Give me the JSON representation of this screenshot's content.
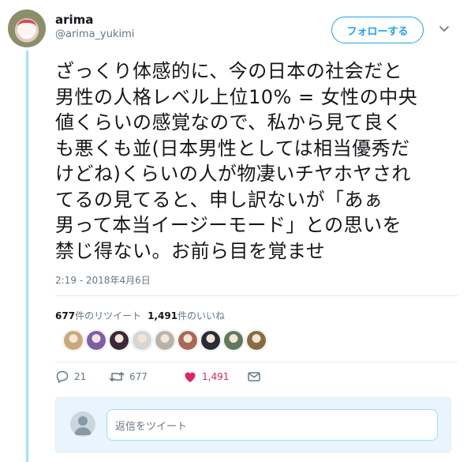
{
  "user": {
    "display_name": "arima",
    "screen_name": "@arima_yukimi",
    "follow_label": "フォローする"
  },
  "tweet": {
    "lines": [
      "ざっくり体感的に、今の日本の社会だと",
      "男性の人格レベル上位10% = 女性の中央",
      "値くらいの感覚なので、私から見て良く",
      "も悪くも並(日本男性としては相当優秀だ",
      "けどね)くらいの人が物凄いチヤホヤされ",
      "てるの見てると、申し訳ないが「あぁ",
      "男って本当イージーモード」との思いを",
      "禁じ得ない。お前ら目を覚ませ"
    ],
    "timestamp": "2:19 - 2018年4月6日"
  },
  "stats": {
    "retweet_count": "677",
    "retweet_label": "件のリツイート",
    "like_count": "1,491",
    "like_label": "件のいいね"
  },
  "likers": [
    {
      "name": "liker-1",
      "color": "#c9a878"
    },
    {
      "name": "liker-2",
      "color": "#7d5fa6"
    },
    {
      "name": "liker-3",
      "color": "#3b2a33"
    },
    {
      "name": "liker-4",
      "color": "#d5d8d2"
    },
    {
      "name": "liker-5",
      "color": "#b9b2a8"
    },
    {
      "name": "liker-6",
      "color": "#a86a52"
    },
    {
      "name": "liker-7",
      "color": "#2c2c35"
    },
    {
      "name": "liker-8",
      "color": "#5f7a5a"
    },
    {
      "name": "liker-9",
      "color": "#8a6b3e"
    }
  ],
  "actions": {
    "reply_count": "21",
    "retweet_count": "677",
    "like_count": "1,491"
  },
  "reply_box": {
    "placeholder": "返信をツイート"
  },
  "colors": {
    "accent": "#1da1f2",
    "like": "#e0245e",
    "thread_line": "#a4e0f7"
  }
}
